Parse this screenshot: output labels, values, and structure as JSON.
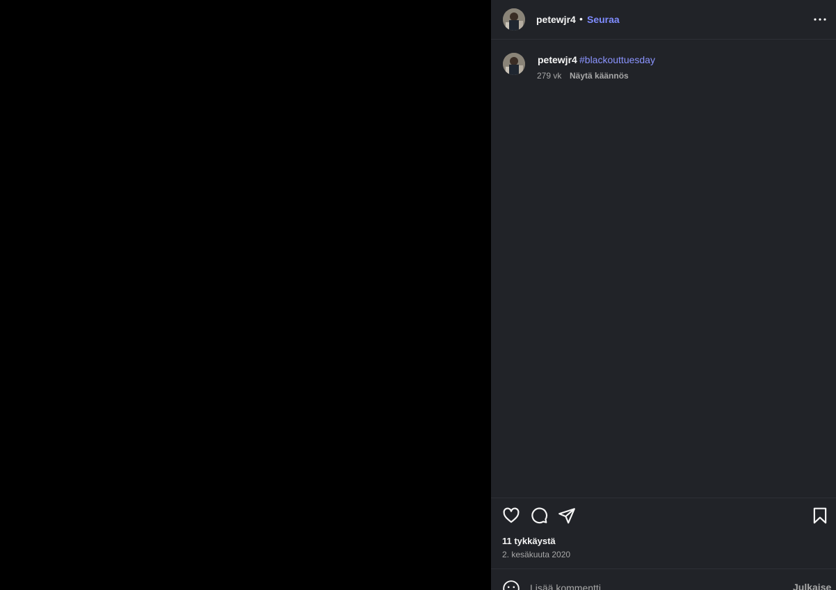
{
  "header": {
    "username": "petewjr4",
    "separator": "•",
    "follow_label": "Seuraa",
    "avatar_icon": "profile-photo",
    "more_icon": "more-options-icon"
  },
  "caption": {
    "username": "petewjr4",
    "text": "#blackouttuesday",
    "time": "279 vk",
    "translate_label": "Näytä käännös"
  },
  "actions": {
    "like_icon": "heart-icon",
    "comment_icon": "comment-icon",
    "share_icon": "send-icon",
    "save_icon": "bookmark-icon"
  },
  "stats": {
    "likes": "11 tykkäystä",
    "date": "2. kesäkuuta 2020"
  },
  "comment": {
    "placeholder": "Lisää kommentti...",
    "post_label": "Julkaise",
    "emoji_icon": "emoji-icon"
  },
  "colors": {
    "panel_bg": "#212328",
    "link_blue": "#7f8cff",
    "media_bg": "#000000"
  }
}
